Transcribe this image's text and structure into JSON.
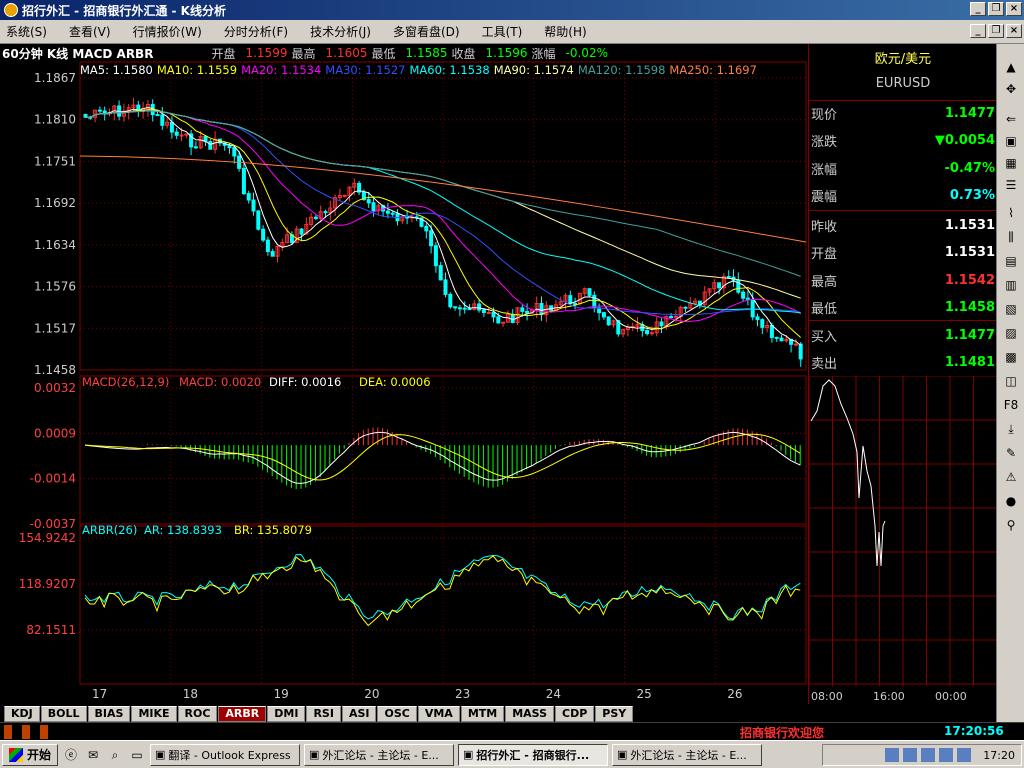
{
  "window": {
    "title": "招行外汇 - 招商银行外汇通 - K线分析"
  },
  "menu": [
    "系统(S)",
    "查看(V)",
    "行情报价(W)",
    "分时分析(F)",
    "技术分析(J)",
    "多窗看盘(D)",
    "工具(T)",
    "帮助(H)"
  ],
  "chart_header": {
    "period": "60分钟 K线 MACD ARBR",
    "open_label": "开盘",
    "open": "1.1599",
    "high_label": "最高",
    "high": "1.1605",
    "low_label": "最低",
    "low": "1.1585",
    "close_label": "收盘",
    "close": "1.1596",
    "change_label": "涨幅",
    "change": "-0.02%"
  },
  "ma_legend": [
    {
      "text": "MA5: 1.1580",
      "color": "#ffffff"
    },
    {
      "text": "MA10: 1.1559",
      "color": "#ffff00"
    },
    {
      "text": "MA20: 1.1534",
      "color": "#ff00ff"
    },
    {
      "text": "MA30: 1.1527",
      "color": "#3050ff"
    },
    {
      "text": "MA60: 1.1538",
      "color": "#00ffff"
    },
    {
      "text": "MA90: 1.1574",
      "color": "#ffffa0"
    },
    {
      "text": "MA120: 1.1598",
      "color": "#40a0a0"
    },
    {
      "text": "MA250: 1.1697",
      "color": "#ff8040"
    }
  ],
  "price_axis": [
    "1.1867",
    "1.1810",
    "1.1751",
    "1.1692",
    "1.1634",
    "1.1576",
    "1.1517",
    "1.1458"
  ],
  "macd_legend": {
    "title": "MACD(26,12,9)",
    "macd": "MACD: 0.0020",
    "diff": "DIFF: 0.0016",
    "dea": "DEA: 0.0006"
  },
  "macd_axis": [
    "0.0032",
    "0.0009",
    "-0.0014",
    "-0.0037"
  ],
  "arbr_legend": {
    "title": "ARBR(26)",
    "ar": "AR: 138.8393",
    "br": "BR: 135.8079"
  },
  "arbr_axis": [
    "154.9242",
    "118.9207",
    "82.1511"
  ],
  "date_axis": [
    "17",
    "18",
    "19",
    "20",
    "23",
    "24",
    "25",
    "26"
  ],
  "tabs": [
    "KDJ",
    "BOLL",
    "BIAS",
    "MIKE",
    "ROC",
    "ARBR",
    "DMI",
    "RSI",
    "ASI",
    "OSC",
    "VMA",
    "MTM",
    "MASS",
    "CDP",
    "PSY"
  ],
  "active_tab": "ARBR",
  "quote_panel": {
    "name": "欧元/美元",
    "code": "EURUSD",
    "rows": [
      {
        "label": "现价",
        "value": "1.1477",
        "color": "#00ff00"
      },
      {
        "label": "涨跌",
        "value": "▼0.0054",
        "color": "#00ff00"
      },
      {
        "label": "涨幅",
        "value": "-0.47%",
        "color": "#00ff00"
      },
      {
        "label": "震幅",
        "value": "0.73%",
        "color": "#00ffff"
      },
      {
        "label": "昨收",
        "value": "1.1531",
        "color": "#ffffff"
      },
      {
        "label": "开盘",
        "value": "1.1531",
        "color": "#ffffff"
      },
      {
        "label": "最高",
        "value": "1.1542",
        "color": "#ff3030"
      },
      {
        "label": "最低",
        "value": "1.1458",
        "color": "#00ff00"
      },
      {
        "label": "买入",
        "value": "1.1477",
        "color": "#00ff00"
      },
      {
        "label": "卖出",
        "value": "1.1481",
        "color": "#00ff00"
      }
    ],
    "time_axis": [
      "08:00",
      "16:00",
      "00:00"
    ]
  },
  "status": {
    "welcome": "招商银行欢迎您",
    "clock": "17:20:56"
  },
  "taskbar": {
    "start": "开始",
    "tasks": [
      {
        "label": "翻译 - Outlook Express",
        "active": false
      },
      {
        "label": "外汇论坛 - 主论坛 - E...",
        "active": false
      },
      {
        "label": "招行外汇 - 招商银行...",
        "active": true
      },
      {
        "label": "外汇论坛 - 主论坛 - E...",
        "active": false
      }
    ],
    "clock": "17:20"
  },
  "colors": {
    "up": "#ff3030",
    "down": "#00ffff",
    "grid": "#800000",
    "axis_text": "#cccccc"
  }
}
